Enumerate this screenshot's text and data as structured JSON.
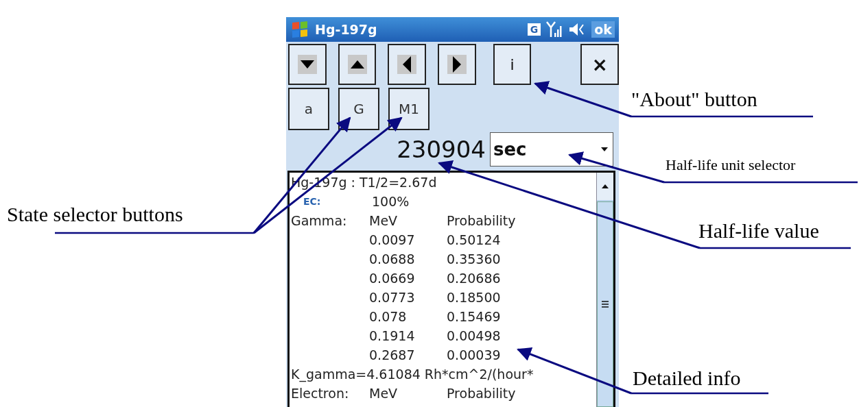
{
  "window": {
    "title": "Hg-197g",
    "indicator": "G",
    "ok": "ok"
  },
  "toolbar": {
    "info": "i",
    "close": "×"
  },
  "state_buttons": [
    {
      "label": "a"
    },
    {
      "label": "G"
    },
    {
      "label": "M1"
    }
  ],
  "half_life": {
    "value": "230904",
    "unit": "sec"
  },
  "details": [
    {
      "kind": "line",
      "text": "Hg-197g : T1/2=2.67d"
    },
    {
      "kind": "columns",
      "label": "EC:",
      "col2": "100%",
      "indent": true
    },
    {
      "kind": "columns",
      "label": "Gamma:",
      "col2": "MeV",
      "col3": "Probability"
    },
    {
      "kind": "columns",
      "col2": "0.0097",
      "col3": "0.50124"
    },
    {
      "kind": "columns",
      "col2": "0.0688",
      "col3": "0.35360"
    },
    {
      "kind": "columns",
      "col2": "0.0669",
      "col3": "0.20686"
    },
    {
      "kind": "columns",
      "col2": "0.0773",
      "col3": "0.18500"
    },
    {
      "kind": "columns",
      "col2": "0.078",
      "col3": "0.15469"
    },
    {
      "kind": "columns",
      "col2": "0.1914",
      "col3": "0.00498"
    },
    {
      "kind": "columns",
      "col2": "0.2687",
      "col3": "0.00039"
    },
    {
      "kind": "line",
      "text": "K_gamma=4.61084 Rh*cm^2/(hour*"
    },
    {
      "kind": "columns",
      "label": "Electron:",
      "col2": "MeV",
      "col3": "Probability"
    }
  ],
  "annotations": [
    {
      "text": "\"About\" button",
      "kind": "large"
    },
    {
      "text": "Half-life unit selector",
      "kind": "small"
    },
    {
      "text": "State selector buttons",
      "kind": "large"
    },
    {
      "text": "Half-life value",
      "kind": "large"
    },
    {
      "text": "Detailed info",
      "kind": "large"
    }
  ]
}
